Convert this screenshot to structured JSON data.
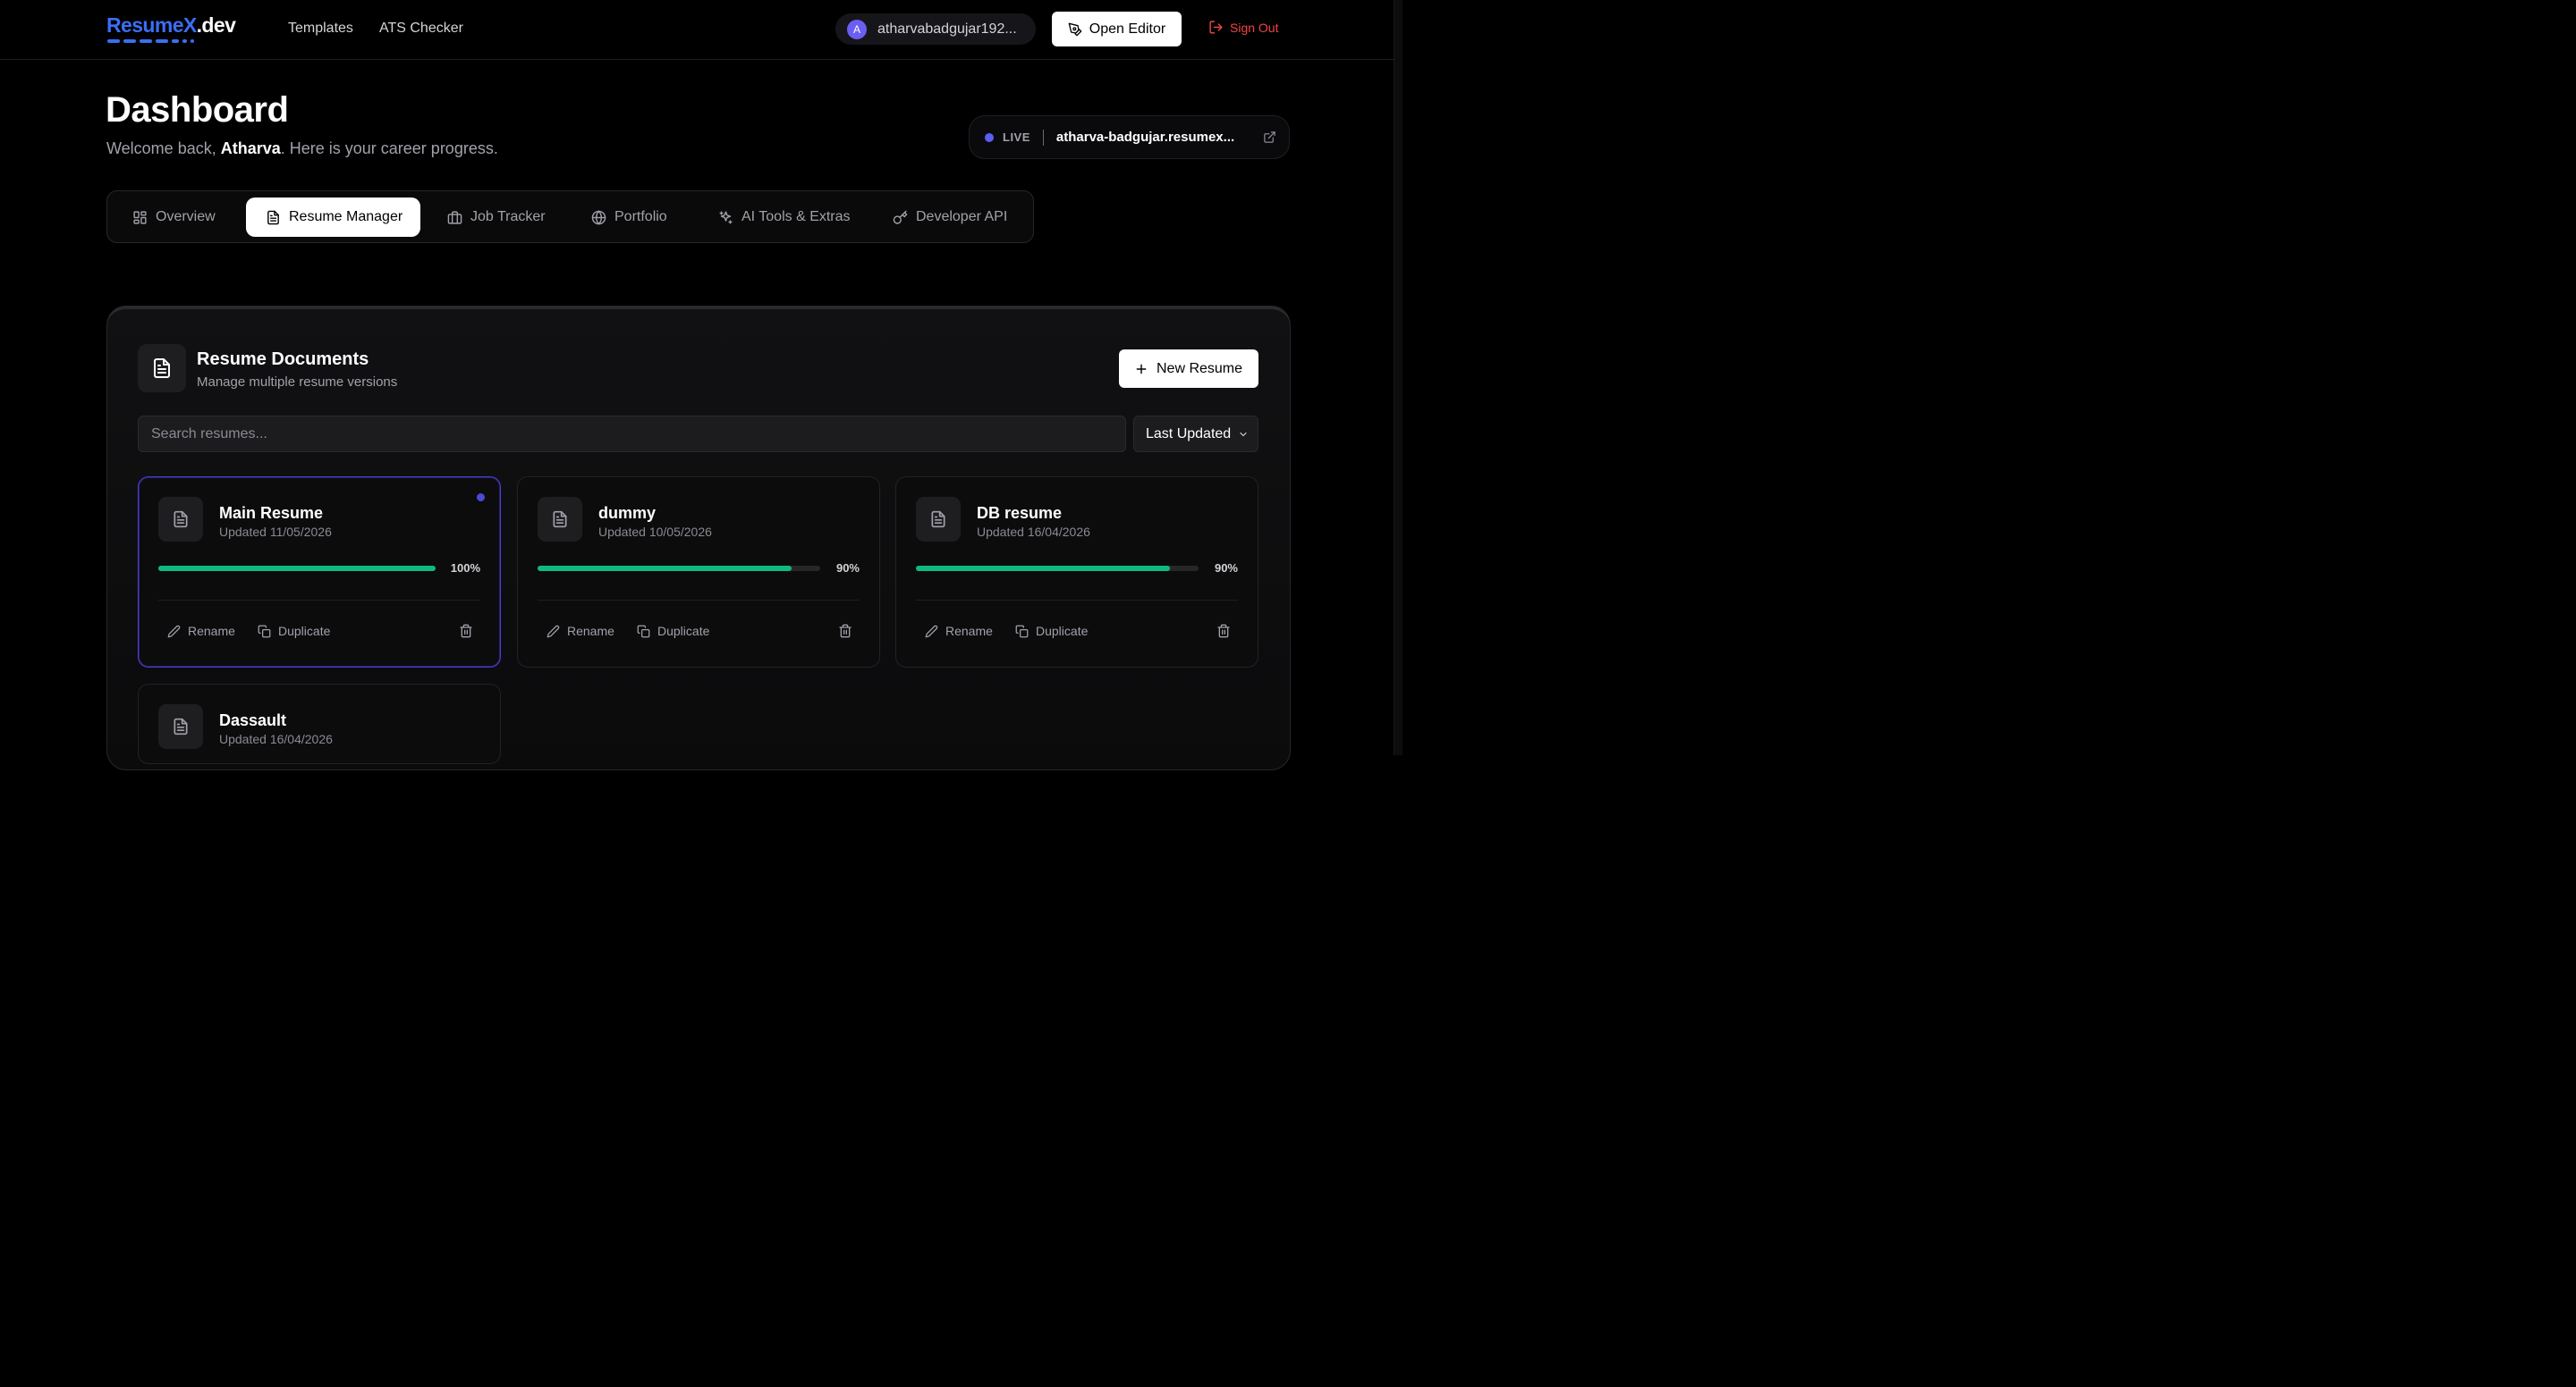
{
  "brand": {
    "logo_main": "Resume",
    "logo_x": "X",
    "logo_suffix": ".dev",
    "accent": "#3b6ef5"
  },
  "nav": {
    "templates": "Templates",
    "ats_checker": "ATS Checker"
  },
  "user": {
    "initial": "A",
    "name": "atharvabadgujar192..."
  },
  "actions": {
    "open_editor": "Open Editor",
    "sign_out": "Sign Out"
  },
  "header": {
    "title": "Dashboard",
    "welcome_prefix": "Welcome back, ",
    "welcome_name": "Atharva",
    "welcome_suffix": ". Here is your career progress."
  },
  "live": {
    "label": "LIVE",
    "url": "atharva-badgujar.resumex..."
  },
  "tabs": [
    {
      "label": "Overview",
      "icon": "grid-icon"
    },
    {
      "label": "Resume Manager",
      "icon": "document-icon",
      "active": true
    },
    {
      "label": "Job Tracker",
      "icon": "briefcase-icon"
    },
    {
      "label": "Portfolio",
      "icon": "globe-icon"
    },
    {
      "label": "AI Tools & Extras",
      "icon": "sparkles-icon"
    },
    {
      "label": "Developer API",
      "icon": "key-icon"
    }
  ],
  "section": {
    "title": "Resume Documents",
    "subtitle": "Manage multiple resume versions",
    "new_resume": "New Resume"
  },
  "search": {
    "placeholder": "Search resumes..."
  },
  "sort": {
    "selected": "Last Updated"
  },
  "card_actions": {
    "rename": "Rename",
    "duplicate": "Duplicate"
  },
  "resumes": [
    {
      "name": "Main Resume",
      "updated": "Updated 11/05/2026",
      "progress": 100,
      "progress_label": "100%",
      "selected": true
    },
    {
      "name": "dummy",
      "updated": "Updated 10/05/2026",
      "progress": 90,
      "progress_label": "90%"
    },
    {
      "name": "DB resume",
      "updated": "Updated 16/04/2026",
      "progress": 90,
      "progress_label": "90%"
    },
    {
      "name": "Dassault",
      "updated": "Updated 16/04/2026"
    }
  ],
  "colors": {
    "progress": "#10b981",
    "danger": "#ef4444",
    "live_dot": "#5b5ef2",
    "selected_border": "#4c3fd6"
  }
}
